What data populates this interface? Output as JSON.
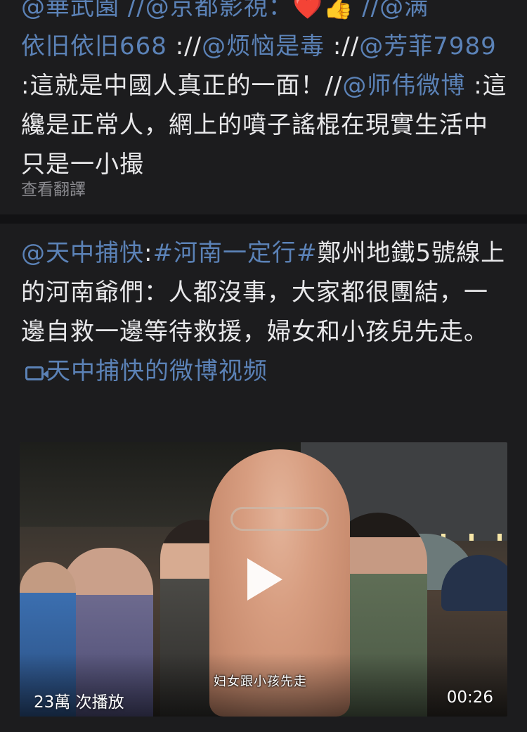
{
  "top_post": {
    "partial_line": "@華武園 //@京都影視：❤️👍 //@满",
    "mentions": [
      "依旧依旧668",
      "@烦恼是毒",
      "@芳菲7989",
      "@师伟微博"
    ],
    "sep": "://",
    "text1": ":這就是中國人真正的一面！//",
    "text2": ":這纔是正常人，網上的噴子謠棍在現實生活中只是一小撮",
    "translate_label": "查看翻譯"
  },
  "main_post": {
    "author_mention": "@天中捕快",
    "colon": ":",
    "hashtag": "#河南一定行#",
    "body": "鄭州地鐵5號線上的河南爺們：人都沒事，大家都很團結，一邊自救一邊等待救援，婦女和小孩兒先走。",
    "video_link": "天中捕快的微博视频"
  },
  "video": {
    "subtitle": "妇女跟小孩先走",
    "plays": "23萬 次播放",
    "duration": "00:26"
  },
  "colors": {
    "background": "#121214",
    "card": "#1c1c1e",
    "link": "#5b82b7",
    "text": "#e8e8ea",
    "muted": "#8b8b90"
  }
}
